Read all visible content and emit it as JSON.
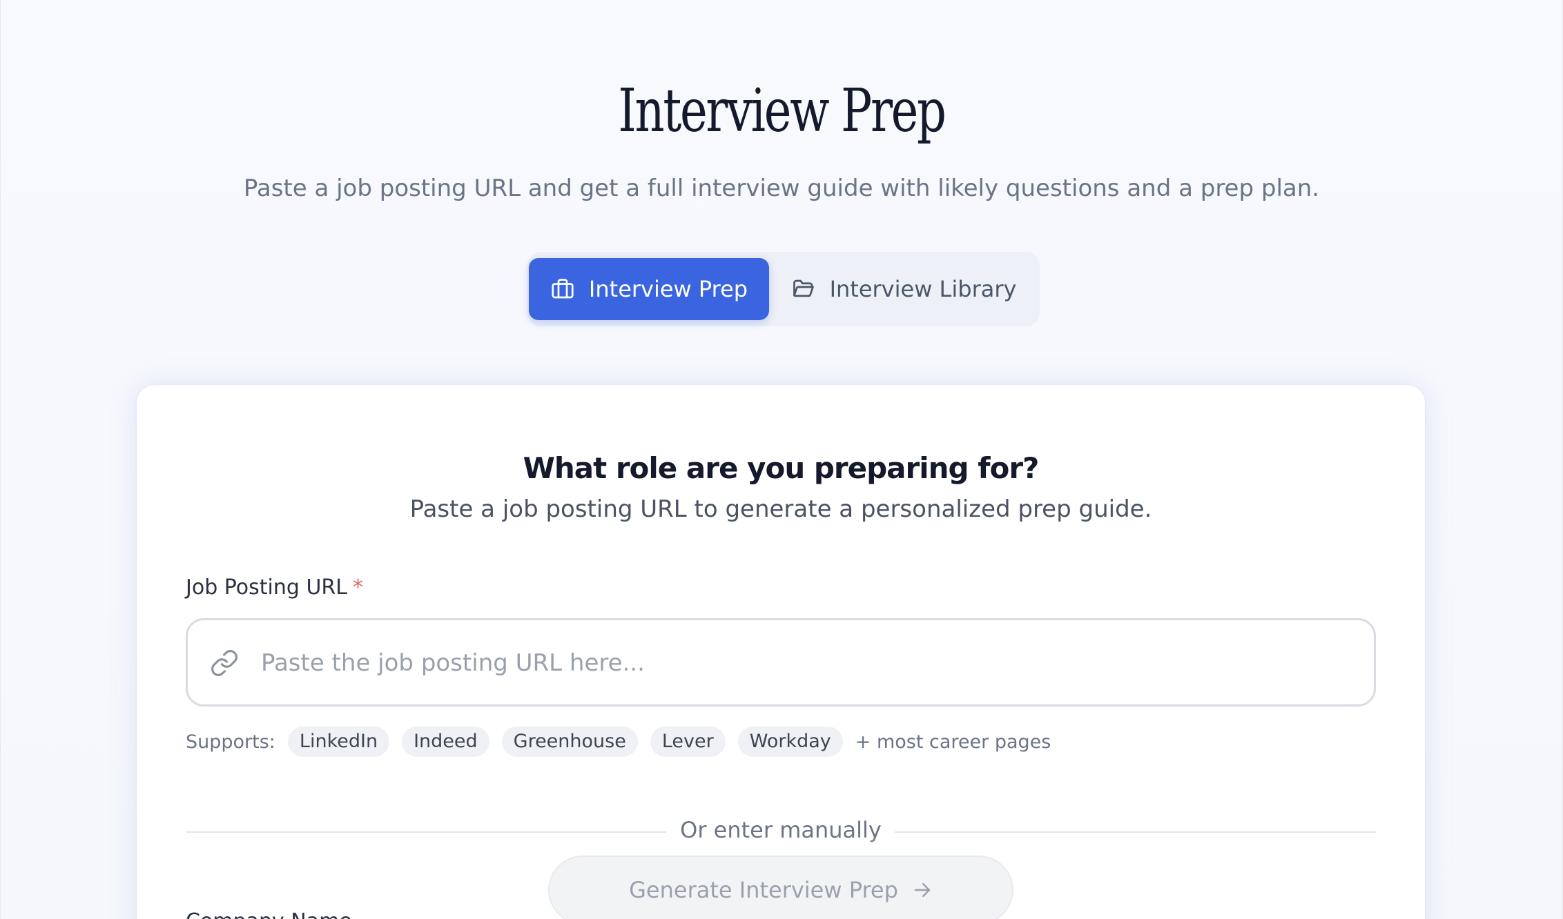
{
  "header": {
    "title": "Interview Prep",
    "subtitle": "Paste a job posting URL and get a full interview guide with likely questions and a prep plan."
  },
  "tabs": [
    {
      "label": "Interview Prep",
      "icon": "briefcase-icon",
      "active": true
    },
    {
      "label": "Interview Library",
      "icon": "folder-icon",
      "active": false
    }
  ],
  "card": {
    "title": "What role are you preparing for?",
    "subtitle": "Paste a job posting URL to generate a personalized prep guide.",
    "url_field": {
      "label": "Job Posting URL",
      "required_mark": "*",
      "placeholder": "Paste the job posting URL here...",
      "value": "",
      "icon": "link-icon"
    },
    "supports": {
      "label": "Supports:",
      "sources": [
        "LinkedIn",
        "Indeed",
        "Greenhouse",
        "Lever",
        "Workday"
      ],
      "more": "+ most career pages"
    },
    "divider_text": "Or enter manually",
    "manual_field_label": "Company Name"
  },
  "generate_button": {
    "label": "Generate Interview Prep",
    "disabled": true,
    "icon": "arrow-right-icon"
  },
  "colors": {
    "accent": "#3b64e0",
    "title": "#141a2b",
    "muted": "#6b7485",
    "required": "#e06060",
    "disabled_bg": "#f2f3f5",
    "disabled_text": "#9aa1ad"
  }
}
